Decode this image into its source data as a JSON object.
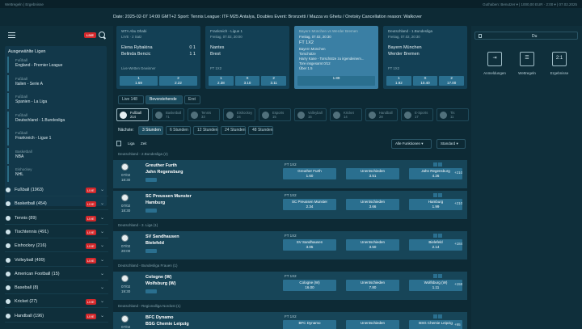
{
  "topbar": {
    "left": "Wettregeln | Ergebnisse",
    "right": "Guthaben: Benutzer  ▾ | 1000,00 EUR · 2:00  ▾ | 07.02.2025"
  },
  "info": "Date: 2025-02-07 14:00 GMT+2 Sport: Tennis League: ITF M25 Antalya, Doubles Event: Bronzetti / Mazza vs Ghetu / Oretsky Cancellation reason: Walkover",
  "sidebar": {
    "live_label": "LIVE",
    "favorites_title": "Ausgewählte Ligen",
    "favorites": [
      {
        "sport": "Fußball",
        "league": "England - Premier League"
      },
      {
        "sport": "Fußball",
        "league": "Italien - Serie A"
      },
      {
        "sport": "Fußball",
        "league": "Spanien - La Liga"
      },
      {
        "sport": "Fußball",
        "league": "Deutschland - 1.Bundesliga"
      },
      {
        "sport": "Fußball",
        "league": "Frankreich - Ligue 1"
      },
      {
        "sport": "Basketball",
        "league": "NBA"
      },
      {
        "sport": "Eishockey",
        "league": "NHL"
      }
    ],
    "sports": [
      {
        "name": "Fußball (1963)",
        "live": true
      },
      {
        "name": "Basketball (454)",
        "live": true
      },
      {
        "name": "Tennis (89)",
        "live": true
      },
      {
        "name": "Tischtennis (491)",
        "live": true
      },
      {
        "name": "Eishockey (216)",
        "live": true
      },
      {
        "name": "Volleyball (499)",
        "live": true
      },
      {
        "name": "American Football (15)",
        "live": false
      },
      {
        "name": "Baseball (8)",
        "live": false
      },
      {
        "name": "Kricket (27)",
        "live": true
      },
      {
        "name": "Handball (196)",
        "live": true
      }
    ]
  },
  "cards": [
    {
      "head": "WTA Abu Dhabi",
      "sub": "LIVE · 2 Satz",
      "t1": "Elena Rybakina",
      "t2": "Belinda Bencic",
      "s1": "0 1",
      "s2": "1 1",
      "market": "Live-Wetten Gewinner",
      "o1": "1",
      "o1v": "1.69",
      "o2": "2",
      "o2v": "2.22"
    },
    {
      "head": "Frankreich - Ligue 1",
      "sub": "Freitag, 07.02, 20:00",
      "t1": "Nantes",
      "t2": "Brest",
      "market": "FT 1X2",
      "o1": "1",
      "o1v": "2.38",
      "ox": "X",
      "oxv": "3.10",
      "o2": "2",
      "o2v": "3.11"
    },
    {
      "head": "Bayern München vs Werder Bremen",
      "sub": "Freitag, 07.02, 20:30",
      "t1": "FT 1X2",
      "lines": [
        "Bayern München",
        "Torschütze",
        "Harry Kane - Torschütze zu irgendeinem...",
        "Tore insgesamt 0/12",
        "Über 1.5"
      ],
      "o1": "",
      "o1v": "1.89"
    },
    {
      "head": "Deutschland - 1.Bundesliga",
      "sub": "Freitag, 07.02, 20:30",
      "t1": "Bayern München",
      "t2": "Werder Bremen",
      "market": "FT 1X2",
      "o1": "1",
      "o1v": "1.92",
      "ox": "X",
      "oxv": "10.40",
      "o2": "2",
      "o2v": "17.00"
    }
  ],
  "rpanel": {
    "tab_label": "Du",
    "btn1": "Anmeldungen",
    "btn2": "Wettregeln",
    "btn3": "Ergebnisse",
    "btn3_icon": "2:1"
  },
  "tabs": [
    "Live",
    "Bevorstehende",
    "Erst"
  ],
  "live_count": "148",
  "sport_filters": [
    {
      "name": "Fußball",
      "count": "214"
    },
    {
      "name": "Basketball",
      "count": "71"
    },
    {
      "name": "Tennis",
      "count": "33"
    },
    {
      "name": "Eishockey",
      "count": "24"
    },
    {
      "name": "Esports",
      "count": "15"
    },
    {
      "name": "Volleyball",
      "count": "15"
    },
    {
      "name": "Kricket",
      "count": "14"
    },
    {
      "name": "Handball",
      "count": "28"
    },
    {
      "name": "E-Sports",
      "count": "17"
    },
    {
      "name": "Tis",
      "count": "11"
    }
  ],
  "nachste": {
    "label": "Nächste:",
    "options": [
      "3 Stunden",
      "6 Stunden",
      "12 Stunden",
      "24 Stunden",
      "48 Stunden"
    ]
  },
  "filterbar": {
    "liga": "Liga",
    "zeit": "Zeit",
    "funktionen": "Alle Funktionen",
    "sort": "Standard"
  },
  "matches": [
    {
      "section": "Deutschland - 2.Bundesliga (2)",
      "t1": "Greuther Furth",
      "t2": "Jahn Regensburg",
      "date": "07/02",
      "time": "18:30",
      "market": "FT 1X2",
      "o1": "Greuther Furth",
      "o1v": "1.60",
      "ox": "Unentschieden",
      "oxv": "3.51",
      "o2": "Jahn Regensburg",
      "o2v": "4.26",
      "more": "+210"
    },
    {
      "section": "",
      "t1": "SC Preussen Munster",
      "t2": "Hamburg",
      "date": "07/02",
      "time": "18:30",
      "market": "FT 1X2",
      "o1": "SC Preussen Munster",
      "o1v": "2.34",
      "ox": "Unentschieden",
      "oxv": "3.66",
      "o2": "Hamburg",
      "o2v": "1.99",
      "more": "+210"
    },
    {
      "section": "Deutschland - 3. Liga (1)",
      "t1": "SV Sandhausen",
      "t2": "Bielefeld",
      "date": "07/02",
      "time": "20:00",
      "market": "FT 1X2",
      "o1": "SV Sandhausen",
      "o1v": "3.05",
      "ox": "Unentschieden",
      "oxv": "3.50",
      "o2": "Bielefeld",
      "o2v": "2.14",
      "more": "+184"
    },
    {
      "section": "Deutschland - Bundesliga Frauen (1)",
      "t1": "Cologne (W)",
      "t2": "Wolfsburg (W)",
      "date": "07/02",
      "time": "19:30",
      "market": "FT 1X2",
      "o1": "Cologne (W)",
      "o1v": "16.00",
      "ox": "Unentschieden",
      "oxv": "7.80",
      "o2": "Wolfsburg (W)",
      "o2v": "1.11",
      "more": "+158"
    },
    {
      "section": "Deutschland - Regionalliga Nordost (1)",
      "t1": "BFC Dynamo",
      "t2": "BSG Chemie Leipzig",
      "date": "07/02",
      "time": "19:00",
      "market": "FT 1X2",
      "o1": "BFC Dynamo",
      "o1v": "",
      "ox": "Unentschieden",
      "oxv": "",
      "o2": "BSG Chemie Leipzig",
      "o2v": "",
      "more": "+95"
    }
  ]
}
